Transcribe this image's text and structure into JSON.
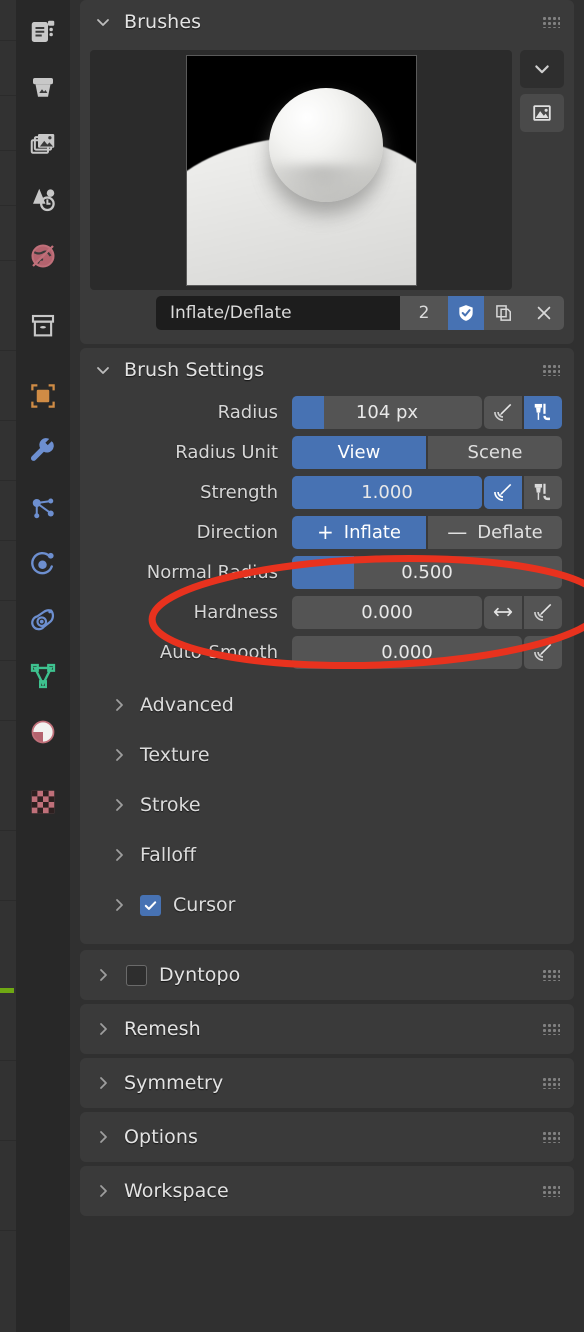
{
  "window": {
    "background": "#303030",
    "accent_blue": "#4772b3",
    "annotation_color": "#e8321e"
  },
  "rail": {
    "items": [
      {
        "name": "tool-tab",
        "icon": "tool-clipboard-icon",
        "color": "#c8c8c8"
      },
      {
        "name": "render-tab",
        "icon": "render-camera-back-icon",
        "color": "#c8c8c8"
      },
      {
        "name": "output-tab",
        "icon": "output-printer-icon",
        "color": "#c8c8c8"
      },
      {
        "name": "view-layer-tab",
        "icon": "images-stack-icon",
        "color": "#c8c8c8"
      },
      {
        "name": "scene-tab",
        "icon": "scene-cone-sphere-icon",
        "color": "#c8c8c8"
      },
      {
        "name": "world-tab",
        "icon": "world-globe-icon",
        "color": "#c0707a"
      },
      {
        "name": "collection-tab",
        "icon": "collection-box-icon",
        "color": "#c8c8c8"
      },
      {
        "name": "object-tab",
        "icon": "object-square-brackets-icon",
        "color": "#d08c45"
      },
      {
        "name": "modifier-tab",
        "icon": "wrench-icon",
        "color": "#6d8fd0"
      },
      {
        "name": "particles-tab",
        "icon": "particles-nodes-icon",
        "color": "#6d8fd0"
      },
      {
        "name": "physics-tab",
        "icon": "physics-orbit-icon",
        "color": "#6d8fd0"
      },
      {
        "name": "constraints-tab",
        "icon": "constraint-clamp-icon",
        "color": "#6d8fd0"
      },
      {
        "name": "object-data-tab",
        "icon": "mesh-data-triangle-icon",
        "color": "#3ec28f"
      },
      {
        "name": "material-tab",
        "icon": "material-sphere-icon",
        "color": "#c0707a"
      },
      {
        "name": "texture-tab",
        "icon": "texture-checker-icon",
        "color": "#c0707a"
      }
    ]
  },
  "brushes_panel": {
    "title": "Brushes",
    "expanded": true,
    "preview_alt": "brush-preview-inflate-deflate",
    "side_buttons": [
      {
        "name": "preview-dropdown-button",
        "icon": "chevron-down-icon"
      },
      {
        "name": "preview-image-button",
        "icon": "image-icon"
      }
    ],
    "brush": {
      "name": "Inflate/Deflate",
      "users_count": "2",
      "fake_user_enabled": true,
      "buttons": [
        {
          "name": "fake-user-shield-button",
          "icon": "shield-check-icon"
        },
        {
          "name": "duplicate-brush-button",
          "icon": "copy-icon"
        },
        {
          "name": "unlink-brush-button",
          "icon": "close-x-icon"
        }
      ]
    }
  },
  "brush_settings_panel": {
    "title": "Brush Settings",
    "expanded": true,
    "rows": {
      "radius": {
        "label": "Radius",
        "value": "104 px",
        "fill_percent": 17,
        "pressure_button": {
          "name": "radius-pressure-button",
          "icon": "pen-pressure-icon",
          "active": false
        },
        "unit_button": {
          "name": "radius-unit-pressure-button",
          "icon": "brush-unified-icon",
          "active": true
        }
      },
      "radius_unit": {
        "label": "Radius Unit",
        "options": [
          {
            "label": "View",
            "active": true
          },
          {
            "label": "Scene",
            "active": false
          }
        ]
      },
      "strength": {
        "label": "Strength",
        "value": "1.000",
        "fill_percent": 100,
        "pressure_button": {
          "name": "strength-pressure-button",
          "icon": "pen-pressure-icon",
          "active": true
        },
        "unit_button": {
          "name": "strength-unified-button",
          "icon": "brush-unified-icon",
          "active": false
        }
      },
      "direction": {
        "label": "Direction",
        "options": [
          {
            "label": "Inflate",
            "sign": "+",
            "active": true
          },
          {
            "label": "Deflate",
            "sign": "—",
            "active": false
          }
        ]
      },
      "normal_radius": {
        "label": "Normal Radius",
        "value": "0.500",
        "fill_percent": 23
      },
      "hardness": {
        "label": "Hardness",
        "value": "0.000",
        "fill_percent": 0,
        "buttons": [
          {
            "name": "hardness-distance-button",
            "icon": "arrows-horizontal-icon",
            "active": false
          },
          {
            "name": "hardness-pressure-button",
            "icon": "pen-pressure-icon",
            "active": false
          }
        ]
      },
      "auto_smooth": {
        "label": "Auto-Smooth",
        "value": "0.000",
        "fill_percent": 0,
        "buttons": [
          {
            "name": "auto-smooth-pressure-button",
            "icon": "pen-pressure-icon",
            "active": false
          }
        ]
      }
    },
    "subsections": [
      {
        "label": "Advanced",
        "expanded": false,
        "checkbox": null
      },
      {
        "label": "Texture",
        "expanded": false,
        "checkbox": null
      },
      {
        "label": "Stroke",
        "expanded": false,
        "checkbox": null
      },
      {
        "label": "Falloff",
        "expanded": false,
        "checkbox": null
      },
      {
        "label": "Cursor",
        "expanded": false,
        "checkbox": true
      }
    ]
  },
  "bottom_panels": [
    {
      "label": "Dyntopo",
      "expanded": false,
      "checkbox": false
    },
    {
      "label": "Remesh",
      "expanded": false,
      "checkbox": null
    },
    {
      "label": "Symmetry",
      "expanded": false,
      "checkbox": null
    },
    {
      "label": "Options",
      "expanded": false,
      "checkbox": null
    },
    {
      "label": "Workspace",
      "expanded": false,
      "checkbox": null
    }
  ],
  "annotation": {
    "shape": "ellipse",
    "target": "Direction row",
    "color": "#e8321e"
  }
}
